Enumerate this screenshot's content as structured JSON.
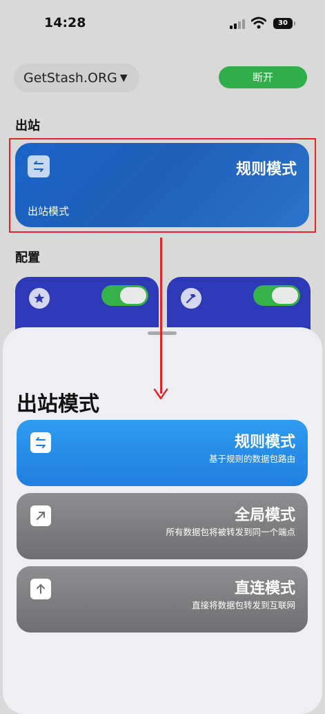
{
  "status_bar": {
    "time": "14:28",
    "battery": "30"
  },
  "header": {
    "profile_name": "GetStash.ORG",
    "disconnect_label": "断开"
  },
  "outbound_section": {
    "label": "出站",
    "card": {
      "title": "规则模式",
      "subtitle": "出站模式"
    }
  },
  "config_section": {
    "label": "配置"
  },
  "sheet": {
    "title": "出站模式",
    "modes": [
      {
        "title": "规则模式",
        "description": "基于规则的数据包路由"
      },
      {
        "title": "全局模式",
        "description": "所有数据包将被转发到同一个端点"
      },
      {
        "title": "直连模式",
        "description": "直接将数据包转发到互联网"
      }
    ]
  },
  "colors": {
    "accent_blue": "#1f7ee0",
    "connected_green": "#2fae4a",
    "annotation_red": "#e0242c"
  }
}
